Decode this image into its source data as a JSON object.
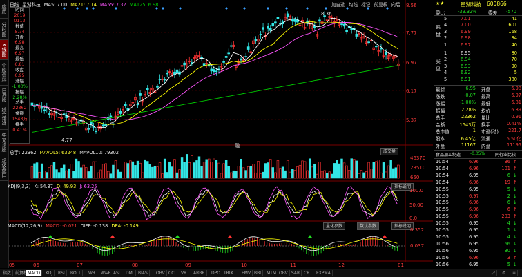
{
  "left_nav": [
    "应用",
    "分时图",
    "K线图",
    "个股资料",
    "自选股",
    "综合排名",
    "牛叉诊股",
    "超级盘口"
  ],
  "period": "日线",
  "main_header": {
    "name": "星湖科技",
    "ma5": "MA5: 7.00",
    "ma21": "MA21: 7.14",
    "ma55": "MA55: 7.32",
    "ma125": "MA125: 6.98"
  },
  "top_toolbar": [
    "加自选",
    "均线",
    "标记",
    "前复权",
    "向后"
  ],
  "info_box": {
    "labels": [
      "时间",
      "2019",
      "0112",
      "数值",
      "5.74",
      "开盘",
      "6.98",
      "最高",
      "6.97",
      "最低",
      "6.81",
      "收盘",
      "6.95",
      "涨幅",
      "-1.00%",
      "振幅",
      "2.28%",
      "总手",
      "22362",
      "金额",
      "1543万",
      "换手",
      "0.41%"
    ]
  },
  "price_axis": [
    "8.56",
    "7.77",
    "6.97",
    "6.17",
    "5.37"
  ],
  "annotations": {
    "high": "8.36",
    "low": "4.77",
    "marker": "融"
  },
  "volume_header": {
    "label": "总手: 22362",
    "mavol5": "MAVOL5: 63248",
    "mavol10": "MAVOL10: 79302",
    "button": "成交量"
  },
  "volume_axis": [
    "46370",
    "23510",
    "650"
  ],
  "kdj_header": {
    "label": "KDJ(9,3,3)",
    "k": "K: 54.37",
    "d": "D: 49.93",
    "j": "J: 63.25",
    "button": "指标说明"
  },
  "kdj_axis": [
    "100.0",
    "50.00",
    "0.0"
  ],
  "macd_header": {
    "label": "MACD(12,26,9)",
    "macd": "MACD: -0.021",
    "diff": "DIFF: -0.138",
    "dea": "DEA: -0.149",
    "btn1": "量化参数",
    "btn2": "数认参数",
    "btn3": "指标说明"
  },
  "macd_axis": [
    "0.352",
    "0.037"
  ],
  "date_axis": [
    "05",
    "06",
    "07",
    "08",
    "09",
    "10",
    "11",
    "12",
    "01"
  ],
  "right_panel": {
    "stock_name": "星湖科技",
    "code": "600866",
    "weibi_label": "委比",
    "weibi_value": "-39.32%",
    "weicha_label": "委差",
    "weicha_value": "-570",
    "sell_label": "卖盘",
    "buy_label": "买盘",
    "sells": [
      [
        "5",
        "7.01",
        "41"
      ],
      [
        "4",
        "7.00",
        "1601"
      ],
      [
        "3",
        "6.99",
        "168"
      ],
      [
        "2",
        "6.98",
        "34"
      ],
      [
        "1",
        "6.97",
        "40"
      ]
    ],
    "buys": [
      [
        "1",
        "6.95",
        "80"
      ],
      [
        "2",
        "6.94",
        "70"
      ],
      [
        "3",
        "6.93",
        "90"
      ],
      [
        "4",
        "6.92",
        "5"
      ],
      [
        "5",
        "6.91",
        "380"
      ]
    ],
    "stats": [
      [
        "最新",
        "6.95",
        "开盘",
        "6.98"
      ],
      [
        "涨跌",
        "-0.07",
        "最高",
        "6.97"
      ],
      [
        "涨幅",
        "-1.00%",
        "最低",
        "6.81"
      ],
      [
        "振幅",
        "2.28%",
        "均价",
        "6.89"
      ],
      [
        "总手",
        "22362",
        "量比",
        "0.91"
      ],
      [
        "金额",
        "1543万",
        "换手",
        "0.41%"
      ],
      [
        "总市值",
        "1",
        "市盈(动)",
        "221.7"
      ],
      [
        "股本",
        "6.45亿",
        "流通",
        "5.50亿"
      ],
      [
        "外盘",
        "11167",
        "内盘",
        "11195"
      ]
    ],
    "industry_left": "食品加工制造",
    "industry_mid": "-0.05%",
    "industry_right": "同行业比较",
    "ticks": [
      [
        "10:54",
        "6.96",
        "36",
        "up"
      ],
      [
        "10:54",
        "6.96",
        "101",
        "up"
      ],
      [
        "10:54",
        "6.95",
        "6",
        "dn"
      ],
      [
        "10:54",
        "6.96",
        "19",
        "up"
      ],
      [
        "10:55",
        "6.95",
        "5",
        "dn"
      ],
      [
        "10:55",
        "6.97",
        "2",
        "dn"
      ],
      [
        "10:55",
        "6.96",
        "6",
        "dn"
      ],
      [
        "10:55",
        "6.96",
        "6",
        "up"
      ],
      [
        "10:55",
        "6.96",
        "203",
        "up"
      ],
      [
        "10:55",
        "6.95",
        "4",
        "dn"
      ],
      [
        "10:55",
        "6.95",
        "1",
        "dn"
      ],
      [
        "10:55",
        "6.95",
        "4",
        "dn"
      ],
      [
        "10:56",
        "6.95",
        "66",
        "dn"
      ],
      [
        "10:56",
        "6.95",
        "30",
        "dn"
      ],
      [
        "10:56",
        "6.96",
        "3",
        "up"
      ],
      [
        "10:56",
        "6.95",
        "5",
        "dn"
      ]
    ]
  },
  "bottom_tabs": [
    "指数",
    "前复权",
    "MACD",
    "KDJ",
    "RSI",
    "BOLL",
    "WR",
    "W&R",
    "ASI",
    "DMI",
    "BIAS",
    "OBV",
    "CCI",
    "VR",
    "ARBR",
    "DPO",
    "TRIX",
    "EMV",
    "BBI",
    "MTM",
    "OBV",
    "SAR",
    "CR",
    "EXPMA"
  ],
  "bottom_right_icons": [
    "expand-icon",
    "settings-icon",
    "menu-icon"
  ],
  "colors": {
    "up": "#ff3333",
    "down": "#33e6e6",
    "ma5": "#ffffff",
    "ma21": "#ffff00",
    "ma55": "#ff55ff",
    "ma125": "#00cc00"
  }
}
